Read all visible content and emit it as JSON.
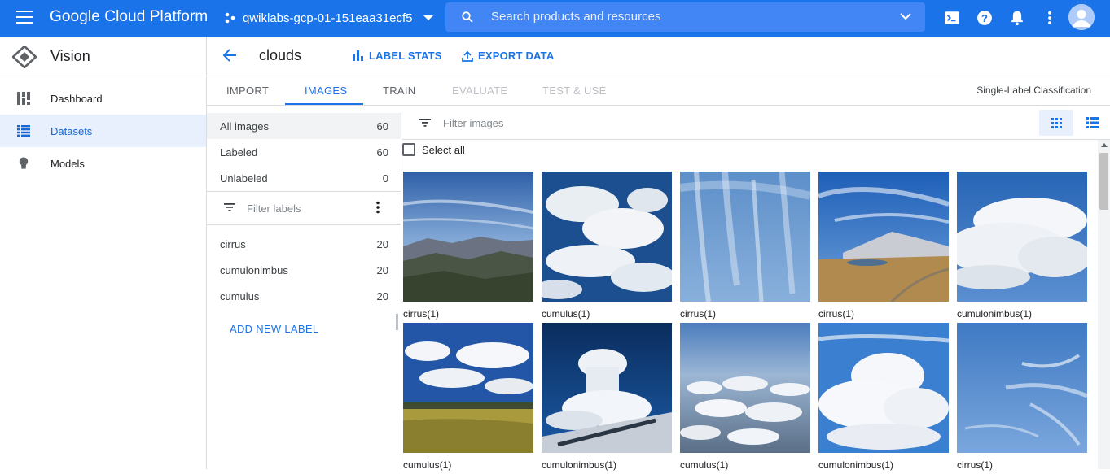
{
  "topbar": {
    "brand": "Google Cloud Platform",
    "project": "qwiklabs-gcp-01-151eaa31ecf5",
    "search_placeholder": "Search products and resources",
    "icons": [
      "menu-icon",
      "project-icon",
      "search-icon",
      "chevron-down-icon",
      "cloud-shell-icon",
      "help-icon",
      "notifications-icon",
      "more-vert-icon",
      "avatar"
    ],
    "color": "#1a73e8"
  },
  "leftnav": {
    "title": "Vision",
    "items": [
      {
        "label": "Dashboard",
        "icon": "dashboard-icon",
        "active": false
      },
      {
        "label": "Datasets",
        "icon": "list-icon",
        "active": true
      },
      {
        "label": "Models",
        "icon": "lightbulb-icon",
        "active": false
      }
    ]
  },
  "header": {
    "title": "clouds",
    "label_stats": "LABEL STATS",
    "export_data": "EXPORT DATA"
  },
  "tabs": {
    "items": [
      {
        "label": "IMPORT",
        "state": "normal"
      },
      {
        "label": "IMAGES",
        "state": "active"
      },
      {
        "label": "TRAIN",
        "state": "normal"
      },
      {
        "label": "EVALUATE",
        "state": "disabled"
      },
      {
        "label": "TEST & USE",
        "state": "disabled"
      }
    ],
    "classification": "Single-Label Classification"
  },
  "filters": {
    "rows": [
      {
        "label": "All images",
        "count": "60"
      },
      {
        "label": "Labeled",
        "count": "60"
      },
      {
        "label": "Unlabeled",
        "count": "0"
      }
    ],
    "filter_labels_placeholder": "Filter labels",
    "labels": [
      {
        "label": "cirrus",
        "count": "20"
      },
      {
        "label": "cumulonimbus",
        "count": "20"
      },
      {
        "label": "cumulus",
        "count": "20"
      }
    ],
    "add_label": "ADD NEW LABEL"
  },
  "images": {
    "filter_placeholder": "Filter images",
    "select_all": "Select all",
    "items": [
      {
        "caption": "cirrus(1)"
      },
      {
        "caption": "cumulus(1)"
      },
      {
        "caption": "cirrus(1)"
      },
      {
        "caption": "cirrus(1)"
      },
      {
        "caption": "cumulonimbus(1)"
      },
      {
        "caption": "cumulus(1)"
      },
      {
        "caption": "cumulonimbus(1)"
      },
      {
        "caption": "cumulus(1)"
      },
      {
        "caption": "cumulonimbus(1)"
      },
      {
        "caption": "cirrus(1)"
      }
    ]
  }
}
